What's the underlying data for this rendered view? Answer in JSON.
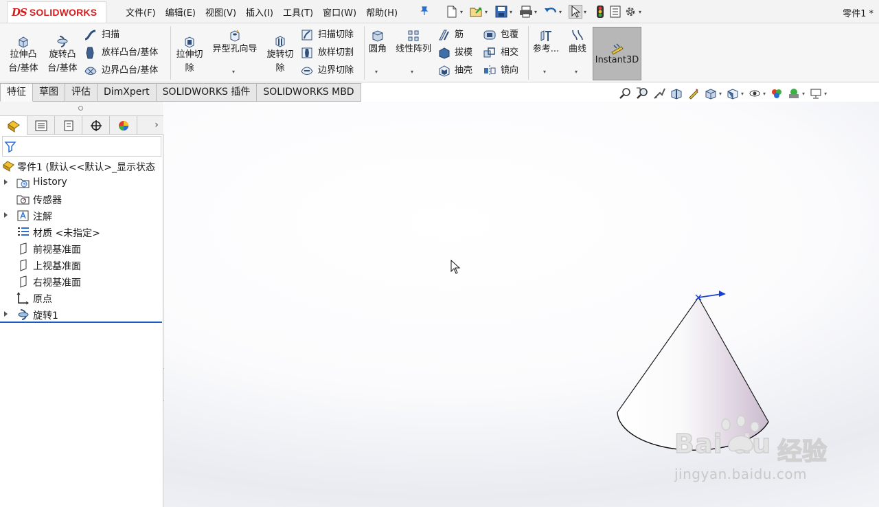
{
  "app": {
    "logo_ds": "DS",
    "logo_name": "SOLIDWORKS",
    "document_title": "零件1 *"
  },
  "menu": [
    "文件(F)",
    "编辑(E)",
    "视图(V)",
    "插入(I)",
    "工具(T)",
    "窗口(W)",
    "帮助(H)"
  ],
  "quick_access": [
    "new-icon",
    "open-icon",
    "save-icon",
    "print-icon",
    "undo-icon",
    "select-icon",
    "rebuild-icon",
    "file-properties-icon",
    "options-icon"
  ],
  "ribbon": {
    "extrude_boss": "拉伸凸\n台/基体",
    "revolve_boss": "旋转凸\n台/基体",
    "sweep": "扫描",
    "loft_boss": "放样凸台/基体",
    "boundary_boss": "边界凸台/基体",
    "extrude_cut": "拉伸切\n除",
    "hole_wizard": "异型孔向导",
    "revolve_cut": "旋转切\n除",
    "swept_cut": "扫描切除",
    "lofted_cut": "放样切割",
    "boundary_cut": "边界切除",
    "fillet": "圆角",
    "linear_pattern": "线性阵列",
    "rib": "筋",
    "draft": "拔模",
    "shell": "抽壳",
    "wrap": "包覆",
    "intersect": "相交",
    "mirror": "镜向",
    "reference": "参考...",
    "curves": "曲线",
    "instant3d": "Instant3D"
  },
  "tabs": [
    "特征",
    "草图",
    "评估",
    "DimXpert",
    "SOLIDWORKS 插件",
    "SOLIDWORKS MBD"
  ],
  "active_tab": 0,
  "tree": {
    "root": "零件1  (默认<<默认>_显示状态",
    "nodes": [
      {
        "label": "History",
        "expandable": true,
        "icon": "history-folder-icon"
      },
      {
        "label": "传感器",
        "expandable": false,
        "icon": "sensor-icon"
      },
      {
        "label": "注解",
        "expandable": true,
        "icon": "annotation-icon"
      },
      {
        "label": "材质 <未指定>",
        "expandable": false,
        "icon": "material-icon"
      },
      {
        "label": "前视基准面",
        "expandable": false,
        "icon": "plane-icon"
      },
      {
        "label": "上视基准面",
        "expandable": false,
        "icon": "plane-icon"
      },
      {
        "label": "右视基准面",
        "expandable": false,
        "icon": "plane-icon"
      },
      {
        "label": "原点",
        "expandable": false,
        "icon": "origin-icon"
      },
      {
        "label": "旋转1",
        "expandable": true,
        "icon": "revolve-feature-icon"
      }
    ]
  },
  "watermark": {
    "brand": "Bai  du",
    "cn": "经验",
    "url": "jingyan.baidu.com"
  },
  "colors": {
    "accent_blue": "#1a5fbf",
    "logo_red": "#d22020",
    "instant3d_bg": "#b7b7b7"
  }
}
